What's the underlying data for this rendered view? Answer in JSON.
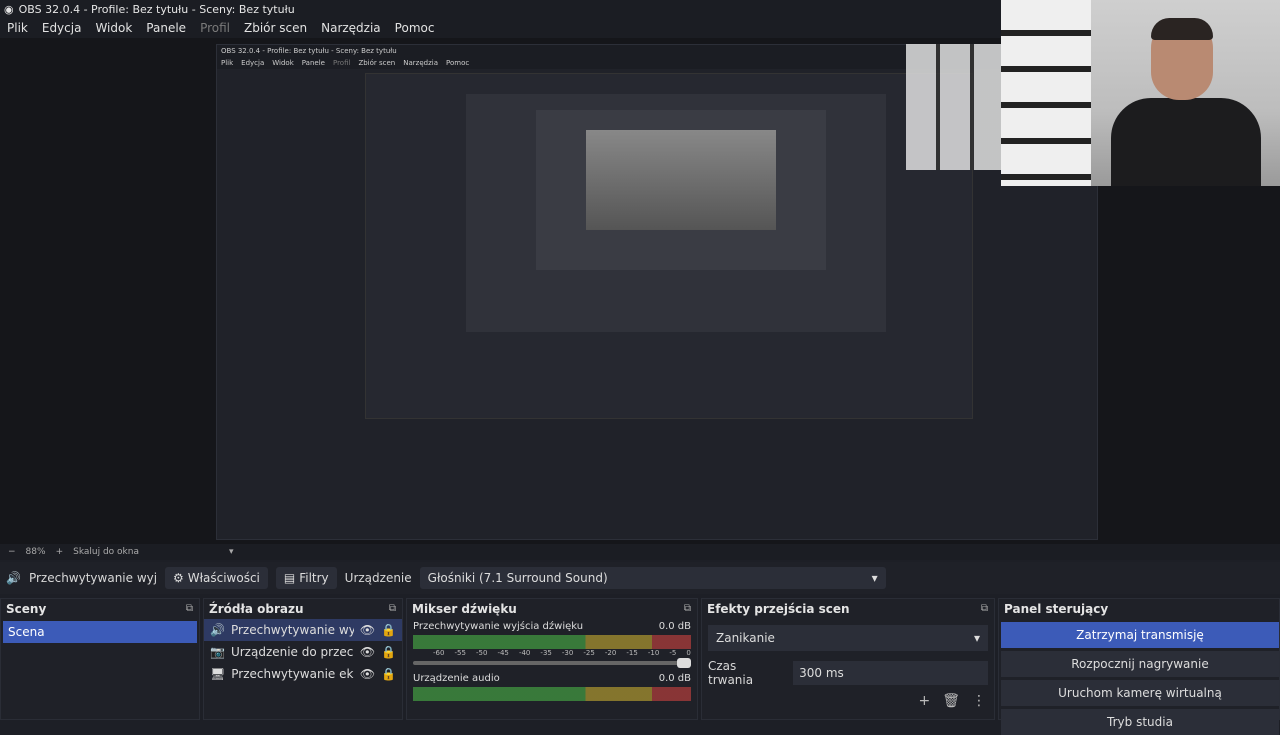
{
  "window": {
    "title": "OBS 32.0.4 - Profile: Bez tytułu - Sceny: Bez tytułu"
  },
  "menu": [
    "Plik",
    "Edycja",
    "Widok",
    "Panele",
    "Profil",
    "Zbiór scen",
    "Narzędzia",
    "Pomoc"
  ],
  "zoom": {
    "minus": "−",
    "value": "88%",
    "plus": "+",
    "fit": "Skaluj do okna"
  },
  "source_bar": {
    "source_name": "Przechwytywanie wyjścia d",
    "properties": "Właściwości",
    "filters": "Filtry",
    "device_label": "Urządzenie",
    "device_value": "Głośniki (7.1 Surround Sound)"
  },
  "scenes": {
    "title": "Sceny",
    "items": [
      "Scena"
    ]
  },
  "sources": {
    "title": "Źródła obrazu",
    "items": [
      "Przechwytywanie wyjścia d",
      "Urządzenie do przechwyty",
      "Przechwytywanie ekranu"
    ]
  },
  "mixer": {
    "title": "Mikser dźwięku",
    "channels": [
      {
        "name": "Przechwytywanie wyjścia dźwięku",
        "db": "0.0 dB"
      },
      {
        "name": "Urządzenie audio",
        "db": "0.0 dB"
      }
    ],
    "ticks": [
      "-60",
      "-55",
      "-50",
      "-45",
      "-40",
      "-35",
      "-30",
      "-25",
      "-20",
      "-15",
      "-10",
      "-5",
      "0"
    ]
  },
  "transitions": {
    "title": "Efekty przejścia scen",
    "effect": "Zanikanie",
    "duration_label": "Czas trwania",
    "duration_value": "300 ms"
  },
  "controls": {
    "title": "Panel sterujący",
    "buttons": [
      "Zatrzymaj transmisję",
      "Rozpocznij nagrywanie",
      "Uruchom kamerę wirtualną",
      "Tryb studia"
    ]
  }
}
